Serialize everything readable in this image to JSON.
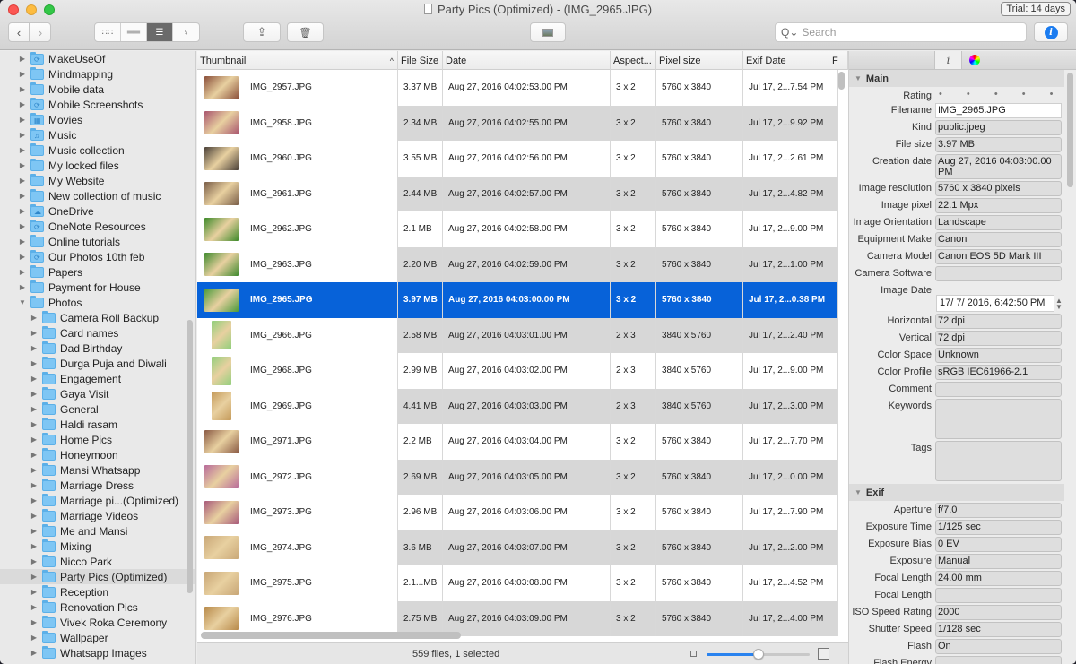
{
  "window": {
    "title": "Party Pics (Optimized) - (IMG_2965.JPG)",
    "trial_badge": "Trial: 14 days"
  },
  "toolbar": {
    "back_icon": "chevron-left-icon",
    "forward_icon": "chevron-right-icon",
    "view_modes": [
      {
        "name": "grid-view",
        "glyph": "▪▪▪",
        "active": false
      },
      {
        "name": "filmstrip-view",
        "glyph": "▭▭",
        "active": false
      },
      {
        "name": "list-view",
        "glyph": "☰",
        "active": true
      },
      {
        "name": "map-view",
        "glyph": "⚲",
        "active": false
      }
    ],
    "share_glyph": "⇪",
    "trash_glyph": "🗑",
    "search_placeholder": "Search",
    "search_glyph": "Q⌄",
    "info_glyph": "i"
  },
  "sidebar": {
    "items": [
      {
        "label": "MakeUseOf",
        "level": 1,
        "expanded": false,
        "badge": "⟳"
      },
      {
        "label": "Mindmapping",
        "level": 1,
        "expanded": false,
        "badge": ""
      },
      {
        "label": "Mobile data",
        "level": 1,
        "expanded": false,
        "badge": ""
      },
      {
        "label": "Mobile Screenshots",
        "level": 1,
        "expanded": false,
        "badge": "⟳"
      },
      {
        "label": "Movies",
        "level": 1,
        "expanded": false,
        "badge": "▦"
      },
      {
        "label": "Music",
        "level": 1,
        "expanded": false,
        "badge": "♫"
      },
      {
        "label": "Music collection",
        "level": 1,
        "expanded": false,
        "badge": ""
      },
      {
        "label": "My locked files",
        "level": 1,
        "expanded": false,
        "badge": ""
      },
      {
        "label": "My Website",
        "level": 1,
        "expanded": false,
        "badge": ""
      },
      {
        "label": "New collection of music",
        "level": 1,
        "expanded": false,
        "badge": ""
      },
      {
        "label": "OneDrive",
        "level": 1,
        "expanded": false,
        "badge": "☁"
      },
      {
        "label": "OneNote Resources",
        "level": 1,
        "expanded": false,
        "badge": "⟳"
      },
      {
        "label": "Online tutorials",
        "level": 1,
        "expanded": false,
        "badge": ""
      },
      {
        "label": "Our Photos 10th feb",
        "level": 1,
        "expanded": false,
        "badge": "⟳"
      },
      {
        "label": "Papers",
        "level": 1,
        "expanded": false,
        "badge": ""
      },
      {
        "label": "Payment for House",
        "level": 1,
        "expanded": false,
        "badge": ""
      },
      {
        "label": "Photos",
        "level": 1,
        "expanded": true,
        "badge": ""
      },
      {
        "label": "Camera Roll Backup",
        "level": 2,
        "expanded": false,
        "badge": ""
      },
      {
        "label": "Card names",
        "level": 2,
        "expanded": false,
        "badge": ""
      },
      {
        "label": "Dad Birthday",
        "level": 2,
        "expanded": false,
        "badge": ""
      },
      {
        "label": "Durga Puja and Diwali",
        "level": 2,
        "expanded": false,
        "badge": ""
      },
      {
        "label": "Engagement",
        "level": 2,
        "expanded": false,
        "badge": ""
      },
      {
        "label": "Gaya Visit",
        "level": 2,
        "expanded": false,
        "badge": ""
      },
      {
        "label": "General",
        "level": 2,
        "expanded": false,
        "badge": ""
      },
      {
        "label": "Haldi rasam",
        "level": 2,
        "expanded": false,
        "badge": ""
      },
      {
        "label": "Home Pics",
        "level": 2,
        "expanded": false,
        "badge": ""
      },
      {
        "label": "Honeymoon",
        "level": 2,
        "expanded": false,
        "badge": ""
      },
      {
        "label": "Mansi Whatsapp",
        "level": 2,
        "expanded": false,
        "badge": ""
      },
      {
        "label": "Marriage Dress",
        "level": 2,
        "expanded": false,
        "badge": ""
      },
      {
        "label": "Marriage pi...(Optimized)",
        "level": 2,
        "expanded": false,
        "badge": ""
      },
      {
        "label": "Marriage Videos",
        "level": 2,
        "expanded": false,
        "badge": ""
      },
      {
        "label": "Me and Mansi",
        "level": 2,
        "expanded": false,
        "badge": ""
      },
      {
        "label": "Mixing",
        "level": 2,
        "expanded": false,
        "badge": ""
      },
      {
        "label": "Nicco Park",
        "level": 2,
        "expanded": false,
        "badge": ""
      },
      {
        "label": "Party Pics (Optimized)",
        "level": 2,
        "expanded": false,
        "badge": "",
        "selected": true
      },
      {
        "label": "Reception",
        "level": 2,
        "expanded": false,
        "badge": ""
      },
      {
        "label": "Renovation Pics",
        "level": 2,
        "expanded": false,
        "badge": ""
      },
      {
        "label": "Vivek Roka Ceremony",
        "level": 2,
        "expanded": false,
        "badge": ""
      },
      {
        "label": "Wallpaper",
        "level": 2,
        "expanded": false,
        "badge": ""
      },
      {
        "label": "Whatsapp Images",
        "level": 2,
        "expanded": false,
        "badge": ""
      }
    ]
  },
  "table": {
    "columns": [
      "Thumbnail",
      "File Size",
      "Date",
      "Aspect...",
      "Pixel size",
      "Exif Date",
      "F"
    ],
    "sort_glyph": "^",
    "rows": [
      {
        "name": "IMG_2957.JPG",
        "size": "3.37 MB",
        "date": "Aug 27, 2016 04:02:53.00 PM",
        "aspect": "3 x 2",
        "pixel": "5760 x 3840",
        "exif": "Jul 17, 2...7.54 PM",
        "thumb": "#8a4f3a",
        "orient": "landscape"
      },
      {
        "name": "IMG_2958.JPG",
        "size": "2.34 MB",
        "date": "Aug 27, 2016 04:02:55.00 PM",
        "aspect": "3 x 2",
        "pixel": "5760 x 3840",
        "exif": "Jul 17, 2...9.92 PM",
        "thumb": "#a9556e",
        "orient": "landscape"
      },
      {
        "name": "IMG_2960.JPG",
        "size": "3.55 MB",
        "date": "Aug 27, 2016 04:02:56.00 PM",
        "aspect": "3 x 2",
        "pixel": "5760 x 3840",
        "exif": "Jul 17, 2...2.61 PM",
        "thumb": "#4a4038",
        "orient": "landscape"
      },
      {
        "name": "IMG_2961.JPG",
        "size": "2.44 MB",
        "date": "Aug 27, 2016 04:02:57.00 PM",
        "aspect": "3 x 2",
        "pixel": "5760 x 3840",
        "exif": "Jul 17, 2...4.82 PM",
        "thumb": "#7a5e48",
        "orient": "landscape"
      },
      {
        "name": "IMG_2962.JPG",
        "size": "2.1 MB",
        "date": "Aug 27, 2016 04:02:58.00 PM",
        "aspect": "3 x 2",
        "pixel": "5760 x 3840",
        "exif": "Jul 17, 2...9.00 PM",
        "thumb": "#3e8a2a",
        "orient": "landscape"
      },
      {
        "name": "IMG_2963.JPG",
        "size": "2.20 MB",
        "date": "Aug 27, 2016 04:02:59.00 PM",
        "aspect": "3 x 2",
        "pixel": "5760 x 3840",
        "exif": "Jul 17, 2...1.00 PM",
        "thumb": "#3f8a2e",
        "orient": "landscape"
      },
      {
        "name": "IMG_2965.JPG",
        "size": "3.97 MB",
        "date": "Aug 27, 2016 04:03:00.00 PM",
        "aspect": "3 x 2",
        "pixel": "5760 x 3840",
        "exif": "Jul 17, 2...0.38 PM",
        "thumb": "#4a9a3a",
        "orient": "landscape",
        "selected": true
      },
      {
        "name": "IMG_2966.JPG",
        "size": "2.58 MB",
        "date": "Aug 27, 2016 04:03:01.00 PM",
        "aspect": "2 x 3",
        "pixel": "3840 x 5760",
        "exif": "Jul 17, 2...2.40 PM",
        "thumb": "#8fcf7a",
        "orient": "portrait"
      },
      {
        "name": "IMG_2968.JPG",
        "size": "2.99 MB",
        "date": "Aug 27, 2016 04:03:02.00 PM",
        "aspect": "2 x 3",
        "pixel": "3840 x 5760",
        "exif": "Jul 17, 2...9.00 PM",
        "thumb": "#92cf7c",
        "orient": "portrait"
      },
      {
        "name": "IMG_2969.JPG",
        "size": "4.41 MB",
        "date": "Aug 27, 2016 04:03:03.00 PM",
        "aspect": "2 x 3",
        "pixel": "3840 x 5760",
        "exif": "Jul 17, 2...3.00 PM",
        "thumb": "#c49a5a",
        "orient": "portrait"
      },
      {
        "name": "IMG_2971.JPG",
        "size": "2.2 MB",
        "date": "Aug 27, 2016 04:03:04.00 PM",
        "aspect": "3 x 2",
        "pixel": "5760 x 3840",
        "exif": "Jul 17, 2...7.70 PM",
        "thumb": "#8a5a44",
        "orient": "landscape"
      },
      {
        "name": "IMG_2972.JPG",
        "size": "2.69 MB",
        "date": "Aug 27, 2016 04:03:05.00 PM",
        "aspect": "3 x 2",
        "pixel": "5760 x 3840",
        "exif": "Jul 17, 2...0.00 PM",
        "thumb": "#b86a9a",
        "orient": "landscape"
      },
      {
        "name": "IMG_2973.JPG",
        "size": "2.96 MB",
        "date": "Aug 27, 2016 04:03:06.00 PM",
        "aspect": "3 x 2",
        "pixel": "5760 x 3840",
        "exif": "Jul 17, 2...7.90 PM",
        "thumb": "#a85a7a",
        "orient": "landscape"
      },
      {
        "name": "IMG_2974.JPG",
        "size": "3.6 MB",
        "date": "Aug 27, 2016 04:03:07.00 PM",
        "aspect": "3 x 2",
        "pixel": "5760 x 3840",
        "exif": "Jul 17, 2...2.00 PM",
        "thumb": "#c9a878",
        "orient": "landscape"
      },
      {
        "name": "IMG_2975.JPG",
        "size": "2.1...MB",
        "date": "Aug 27, 2016 04:03:08.00 PM",
        "aspect": "3 x 2",
        "pixel": "5760 x 3840",
        "exif": "Jul 17, 2...4.52 PM",
        "thumb": "#c8a676",
        "orient": "landscape"
      },
      {
        "name": "IMG_2976.JPG",
        "size": "2.75 MB",
        "date": "Aug 27, 2016 04:03:09.00 PM",
        "aspect": "3 x 2",
        "pixel": "5760 x 3840",
        "exif": "Jul 17, 2...4.00 PM",
        "thumb": "#b88a4a",
        "orient": "landscape"
      }
    ]
  },
  "status": {
    "text": "559 files, 1 selected",
    "thumb_size_fraction": 0.5
  },
  "inspector": {
    "tabs": [
      "",
      "i",
      "color"
    ],
    "main_section": "Main",
    "rating_label": "Rating",
    "rating_dots": "• • • • •",
    "fields": [
      {
        "label": "Filename",
        "value": "IMG_2965.JPG",
        "editable": true
      },
      {
        "label": "Kind",
        "value": "public.jpeg"
      },
      {
        "label": "File size",
        "value": "3.97 MB"
      },
      {
        "label": "Creation date",
        "value": "Aug 27, 2016 04:03:00.00 PM"
      },
      {
        "label": "Image resolution",
        "value": "5760 x 3840 pixels"
      },
      {
        "label": "Image pixel",
        "value": "22.1 Mpx"
      },
      {
        "label": "Image Orientation",
        "value": "Landscape"
      },
      {
        "label": "Equipment Make",
        "value": "Canon"
      },
      {
        "label": "Camera Model",
        "value": "Canon EOS 5D Mark III"
      },
      {
        "label": "Camera Software",
        "value": ""
      }
    ],
    "image_date_label": "Image Date",
    "image_date_value": "17/ 7/ 2016,  6:42:50 PM",
    "fields2": [
      {
        "label": "Horizontal",
        "value": "72 dpi"
      },
      {
        "label": "Vertical",
        "value": "72 dpi"
      },
      {
        "label": "Color Space",
        "value": "Unknown"
      },
      {
        "label": "Color Profile",
        "value": "sRGB IEC61966-2.1"
      },
      {
        "label": "Comment",
        "value": ""
      }
    ],
    "keywords_label": "Keywords",
    "keywords_value": "",
    "tags_label": "Tags",
    "tags_value": "",
    "exif_section": "Exif",
    "exif_fields": [
      {
        "label": "Aperture",
        "value": "f/7.0"
      },
      {
        "label": "Exposure Time",
        "value": "1/125 sec"
      },
      {
        "label": "Exposure Bias",
        "value": "0 EV"
      },
      {
        "label": "Exposure",
        "value": "Manual"
      },
      {
        "label": "Focal Length",
        "value": "24.00 mm"
      },
      {
        "label": "Focal Length",
        "value": ""
      },
      {
        "label": "ISO Speed Rating",
        "value": "2000"
      },
      {
        "label": "Shutter Speed",
        "value": "1/128 sec"
      },
      {
        "label": "Flash",
        "value": "On"
      },
      {
        "label": "Flash Energy",
        "value": ""
      }
    ]
  }
}
